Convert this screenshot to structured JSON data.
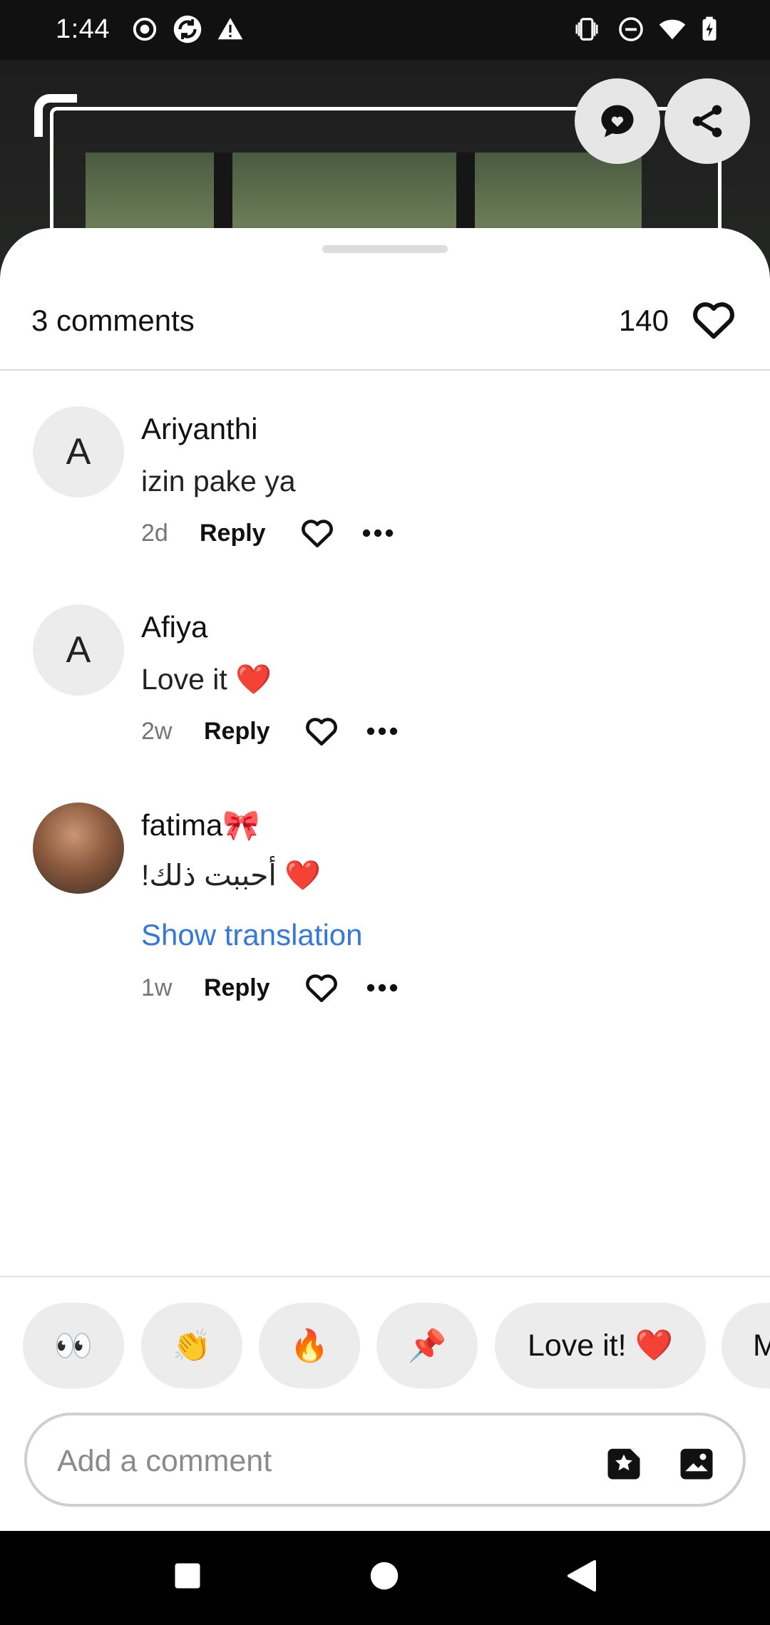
{
  "status_bar": {
    "time": "1:44"
  },
  "sheet": {
    "comment_count": "3 comments",
    "like_count": "140"
  },
  "comments": [
    {
      "avatar_letter": "A",
      "author": "Ariyanthi",
      "text": "izin pake ya",
      "time": "2d",
      "reply_label": "Reply"
    },
    {
      "avatar_letter": "A",
      "author": "Afiya",
      "text": "Love it ❤️",
      "time": "2w",
      "reply_label": "Reply"
    },
    {
      "author": "fatima🎀",
      "text": "❤️ أحببت ذلك!",
      "show_translation": "Show translation",
      "time": "1w",
      "reply_label": "Reply"
    }
  ],
  "quick_reactions": [
    "👀",
    "👏",
    "🔥",
    "📌",
    "Love it! ❤️",
    "M"
  ],
  "input": {
    "placeholder": "Add a comment"
  },
  "colors": {
    "link": "#3479d8",
    "sheet_bg": "#ffffff",
    "chip_bg": "#ececec"
  },
  "icons": [
    "comment-bubble-icon",
    "share-icon",
    "heart-outline-icon",
    "more-dots-icon",
    "sticker-icon",
    "image-icon"
  ]
}
